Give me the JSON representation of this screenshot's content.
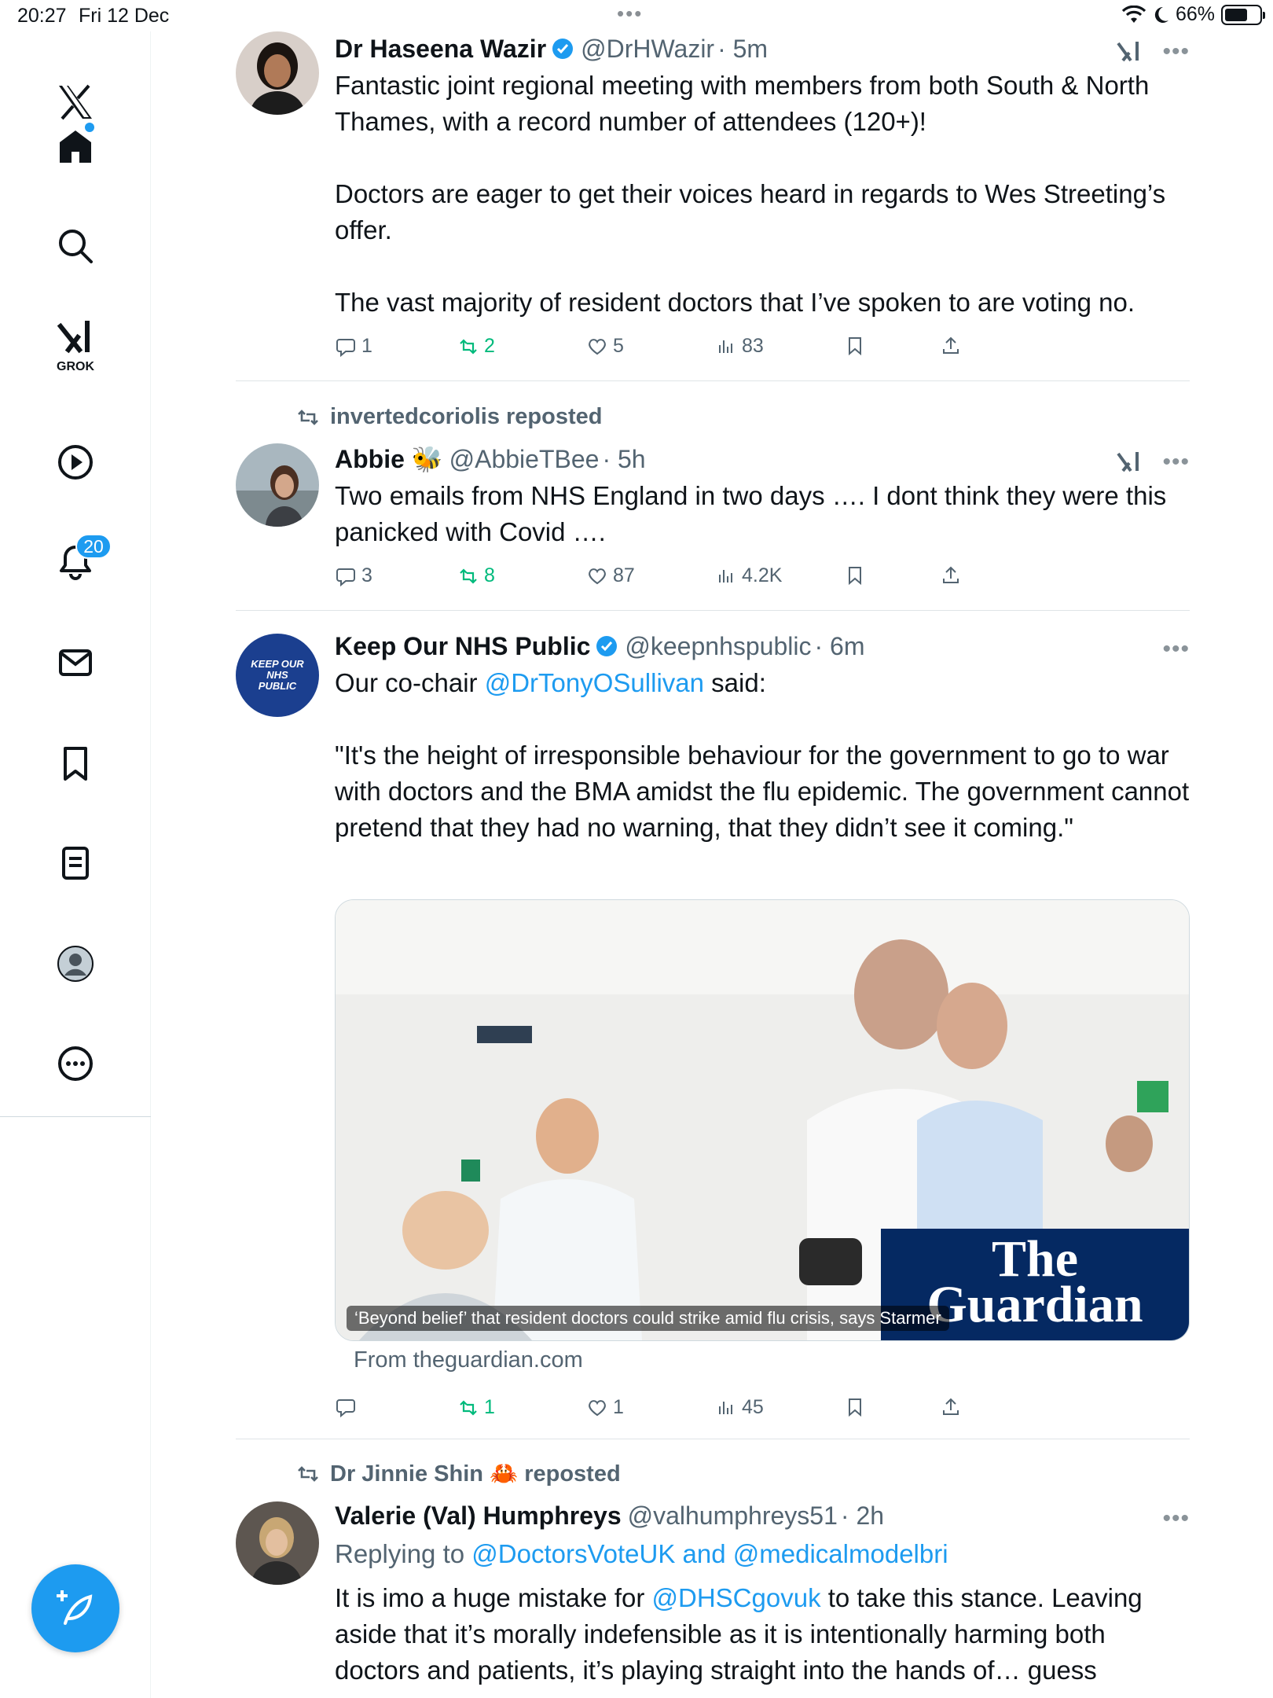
{
  "status_bar": {
    "time": "20:27",
    "date": "Fri 12 Dec",
    "battery": "66%",
    "battery_level": 0.66
  },
  "sidebar": {
    "grok_label": "GROK",
    "notifications_count": "20",
    "items": [
      "x-logo",
      "home",
      "search",
      "grok",
      "video",
      "notifications",
      "messages",
      "bookmarks",
      "lists",
      "profile",
      "more"
    ]
  },
  "tweets": [
    {
      "name": "Dr Haseena Wazir",
      "handle": "@DrHWazir",
      "time": "· 5m",
      "verified": true,
      "text": "Fantastic joint regional meeting with members from both South & North Thames, with a record number of attendees (120+)!\n\nDoctors are eager to get their voices heard in regards to Wes Streeting’s offer.\n\nThe vast majority of resident doctors that I’ve spoken to are voting no.",
      "replies": "1",
      "reposts": "2",
      "likes": "5",
      "views": "83"
    },
    {
      "reposted_by": "invertedcoriolis reposted",
      "name": "Abbie 🐝",
      "handle": "@AbbieTBee",
      "time": "· 5h",
      "text": "Two emails from NHS England in two days …. I dont think they were this panicked with Covid ….",
      "replies": "3",
      "reposts": "8",
      "likes": "87",
      "views": "4.2K"
    },
    {
      "name": "Keep Our NHS Public",
      "handle": "@keepnhspublic",
      "time": "· 6m",
      "verified": true,
      "avatar_text": "KEEP OUR NHS PUBLIC",
      "text_prefix": "Our co-chair ",
      "mention": "@DrTonyOSullivan",
      "text_suffix": " said:\n\n\"It's the height of irresponsible behaviour for the government to go to war with doctors and the BMA amidst the flu epidemic. The government cannot pretend that they had no warning, that they didn’t see it coming.\"",
      "card_caption": "‘Beyond belief’ that resident doctors could strike amid flu crisis, says Starmer",
      "card_brand": "The Guardian",
      "card_from": "From theguardian.com",
      "replies": "",
      "reposts": "1",
      "likes": "1",
      "views": "45"
    },
    {
      "reposted_by": "Dr Jinnie Shin 🦀 reposted",
      "name": "Valerie (Val) Humphreys",
      "handle": "@valhumphreys51",
      "time": "· 2h",
      "replying_prefix": "Replying to ",
      "replying_a": "@DoctorsVoteUK",
      "replying_and": " and ",
      "replying_b": "@medicalmodelbri",
      "text_prefix": "It is imo a huge mistake for ",
      "mention": "@DHSCgovuk",
      "text_suffix": " to take this stance. Leaving aside that it’s morally indefensible as it is intentionally harming both doctors and patients, it’s playing straight into the hands of… guess"
    }
  ],
  "colors": {
    "accent": "#1d9bf0",
    "repost_green": "#00ba7c",
    "secondary_text": "#536471",
    "guardian_blue": "#052962"
  }
}
